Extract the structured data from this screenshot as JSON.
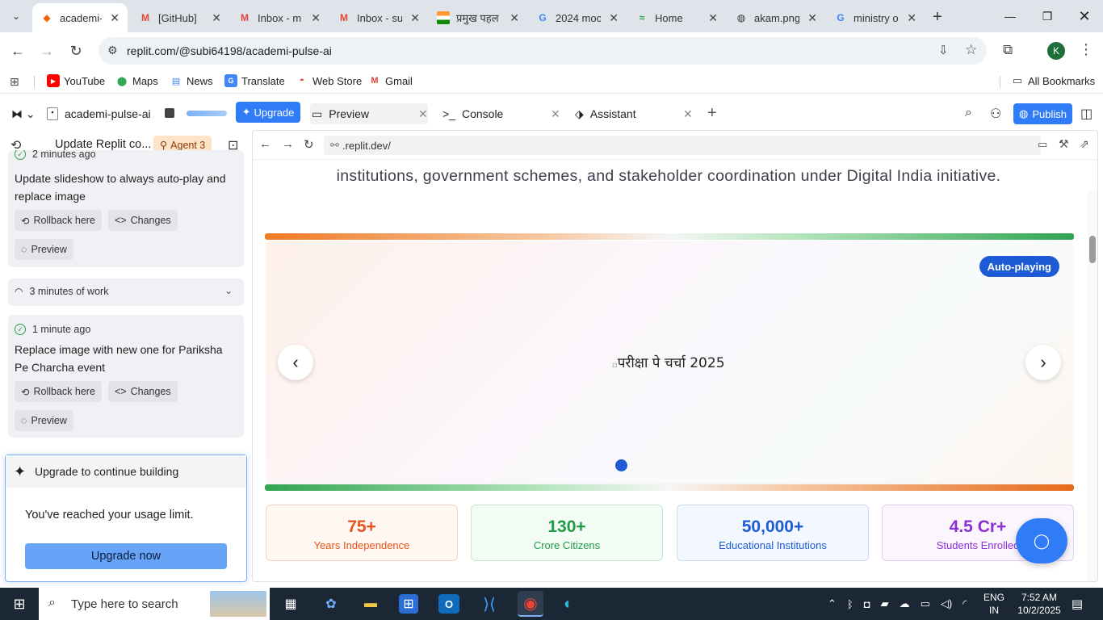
{
  "browser": {
    "tabs": [
      {
        "title": "academi-pulse-ai",
        "icon": "replit-icon",
        "color": "#f26207",
        "active": true
      },
      {
        "title": "[GitHub] Sign in",
        "icon": "gmail-icon",
        "color": "#ea4335"
      },
      {
        "title": "Inbox - m",
        "icon": "gmail-icon",
        "color": "#ea4335"
      },
      {
        "title": "Inbox - su",
        "icon": "gmail-icon",
        "color": "#ea4335"
      },
      {
        "title": "प्रमुख पहल",
        "icon": "india-flag-icon",
        "color": "#ff9933"
      },
      {
        "title": "2024 moc",
        "icon": "google-icon",
        "color": "#4285f4"
      },
      {
        "title": "Home",
        "icon": "home-logo-icon",
        "color": "#2aa14a"
      },
      {
        "title": "akam.png",
        "icon": "globe-icon",
        "color": "#333333"
      },
      {
        "title": "ministry o",
        "icon": "google-icon",
        "color": "#4285f4"
      }
    ],
    "url": "replit.com/@subi64198/academi-pulse-ai",
    "profile_initial": "K",
    "bookmarks": [
      {
        "label": "YouTube",
        "icon": "youtube-icon",
        "color": "#ff0000"
      },
      {
        "label": "Maps",
        "icon": "maps-icon",
        "color": "#34a853"
      },
      {
        "label": "News",
        "icon": "news-icon",
        "color": "#4285f4"
      },
      {
        "label": "Translate",
        "icon": "translate-icon",
        "color": "#4285f4"
      },
      {
        "label": "Web Store",
        "icon": "webstore-icon",
        "color": "#ea4335"
      },
      {
        "label": "Gmail",
        "icon": "gmail-icon",
        "color": "#ea4335"
      }
    ],
    "all_bookmarks": "All Bookmarks"
  },
  "replit": {
    "project_name": "academi-pulse-ai",
    "upgrade_label": "Upgrade",
    "tabs": [
      {
        "label": "Preview",
        "icon": "monitor-icon"
      },
      {
        "label": "Console",
        "icon": "terminal-icon"
      },
      {
        "label": "Assistant",
        "icon": "assistant-icon"
      }
    ],
    "publish_label": "Publish"
  },
  "agent_panel": {
    "title": "Update Replit co...",
    "agent_badge": "Agent 3",
    "entries": [
      {
        "time": "2 minutes ago",
        "message": "Update slideshow to always auto-play and replace image",
        "rollback": "Rollback here",
        "changes": "Changes",
        "preview": "Preview"
      },
      {
        "time": "1 minute ago",
        "message": "Replace image with new one for Pariksha Pe Charcha event",
        "rollback": "Rollback here",
        "changes": "Changes",
        "preview": "Preview"
      }
    ],
    "work_summary": "3 minutes of work",
    "upgrade_card": {
      "title": "Upgrade to continue building",
      "body": "You've reached your usage limit.",
      "button": "Upgrade now"
    }
  },
  "preview_pane": {
    "url": ".replit.dev/",
    "intro_text": "institutions, government schemes, and stakeholder coordination under Digital India initiative.",
    "slideshow": {
      "badge": "Auto-playing",
      "image_alt": "परीक्षा पे चर्चा 2025"
    },
    "stats": [
      {
        "value": "75+",
        "label": "Years Independence",
        "color": "#e8521b",
        "bg": "#fff7f1",
        "border": "#f6d3bd"
      },
      {
        "value": "130+",
        "label": "Crore Citizens",
        "color": "#1f9c45",
        "bg": "#f2fbf4",
        "border": "#c5ead0"
      },
      {
        "value": "50,000+",
        "label": "Educational Institutions",
        "color": "#1d5bd6",
        "bg": "#f3f7fe",
        "border": "#c9daf6"
      },
      {
        "value": "4.5 Cr+",
        "label": "Students Enrolled",
        "color": "#8b2fd6",
        "bg": "#fbf5fe",
        "border": "#e6cff6"
      }
    ]
  },
  "taskbar": {
    "search_placeholder": "Type here to search",
    "lang": "ENG",
    "region": "IN",
    "time": "7:52 AM",
    "date": "10/2/2025"
  }
}
